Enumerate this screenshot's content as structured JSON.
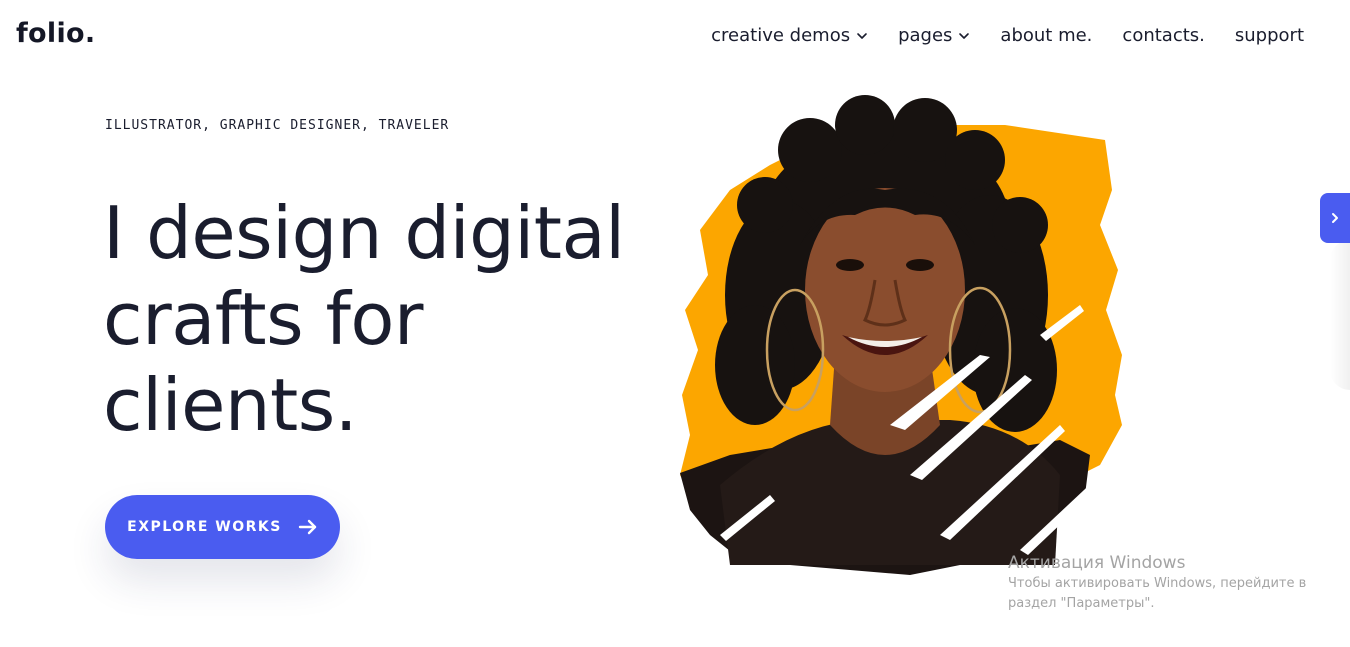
{
  "brand": {
    "logo_text": "folio."
  },
  "nav": {
    "items": [
      {
        "label": "creative demos",
        "has_dropdown": true
      },
      {
        "label": "pages",
        "has_dropdown": true
      },
      {
        "label": "about me.",
        "has_dropdown": false
      },
      {
        "label": "contacts.",
        "has_dropdown": false
      },
      {
        "label": "support",
        "has_dropdown": false
      }
    ]
  },
  "hero": {
    "eyebrow": "ILLUSTRATOR, GRAPHIC DESIGNER, TRAVELER",
    "headline_lines": [
      "I design digital",
      "crafts for",
      "clients."
    ],
    "cta_label": "EXPLORE WORKS",
    "cta_icon": "arrow-right-icon",
    "portrait_subject": "smiling woman with curly hair and hoop earrings",
    "portrait_subject_text": ""
  },
  "side_tab": {
    "icon": "chevron-right-icon"
  },
  "windows_watermark": {
    "title": "Активация Windows",
    "line1": "Чтобы активировать Windows, перейдите в",
    "line2": "раздел \"Параметры\"."
  },
  "colors": {
    "accent": "#4a5cf0",
    "text": "#1a1d2e",
    "brush_yellow": "#fca600",
    "background": "#ffffff"
  }
}
